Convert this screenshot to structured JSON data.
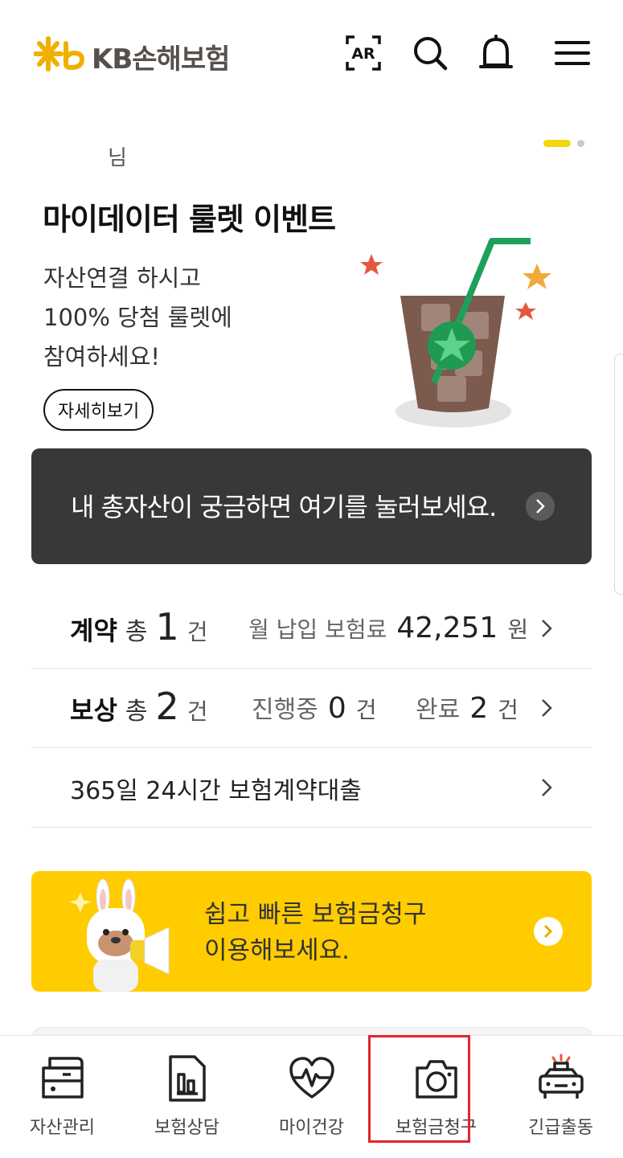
{
  "header": {
    "logo_text": "KB손해보험",
    "icons": [
      "ar-icon",
      "search-icon",
      "bell-icon",
      "menu-icon"
    ],
    "ar_label": "AR"
  },
  "banner": {
    "greeting": "님",
    "title": "마이데이터 룰렛 이벤트",
    "description": "자산연결 하시고\n100% 당첨 룰렛에\n참여하세요!",
    "detail_button": "자세히보기",
    "page_indicator": {
      "current": 1,
      "total": 2
    }
  },
  "assets_bar": {
    "text": "내 총자산이 궁금하면 여기를 눌러보세요."
  },
  "contract_row": {
    "label": "계약",
    "total_word": "총",
    "count": "1",
    "count_unit": "건",
    "premium_label": "월 납입 보험료",
    "premium_value": "42,251",
    "premium_unit": "원"
  },
  "claim_row": {
    "label": "보상",
    "total_word": "총",
    "count": "2",
    "count_unit": "건",
    "in_progress_label": "진행중",
    "in_progress_count": "0",
    "in_progress_unit": "건",
    "done_label": "완료",
    "done_count": "2",
    "done_unit": "건"
  },
  "loan_row": {
    "text": "365일 24시간 보험계약대출"
  },
  "claim_banner": {
    "text": "쉽고 빠른 보험금청구\n이용해보세요."
  },
  "bottom_nav": {
    "items": [
      {
        "label": "자산관리",
        "icon": "asset-icon"
      },
      {
        "label": "보험상담",
        "icon": "document-chart-icon"
      },
      {
        "label": "마이건강",
        "icon": "heart-pulse-icon"
      },
      {
        "label": "보험금청구",
        "icon": "camera-icon",
        "highlighted": true
      },
      {
        "label": "긴급출동",
        "icon": "emergency-car-icon"
      }
    ]
  },
  "colors": {
    "brand_yellow": "#ffcc00",
    "logo_orange": "#f0b000",
    "dark_bar": "#383838",
    "highlight_red": "#e0262b",
    "indicator_yellow": "#f3d70e"
  }
}
